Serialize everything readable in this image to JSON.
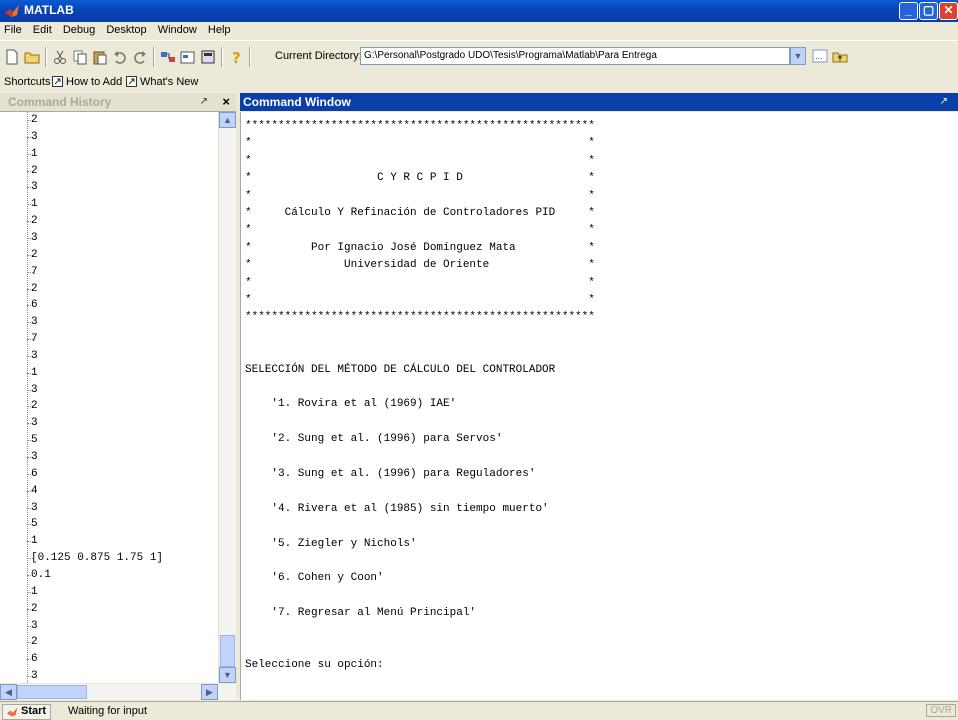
{
  "window": {
    "title": "MATLAB"
  },
  "menu": [
    "File",
    "Edit",
    "Debug",
    "Desktop",
    "Window",
    "Help"
  ],
  "toolbar": {
    "current_directory_label": "Current Directory:",
    "current_directory_value": "G:\\Personal\\Postgrado UDO\\Tesis\\Programa\\Matlab\\Para Entrega"
  },
  "shortcuts": {
    "label": "Shortcuts",
    "how_to_add": "How to Add",
    "whats_new": "What's New"
  },
  "history": {
    "title": "Command History",
    "items": [
      "2",
      "3",
      "1",
      "2",
      "3",
      "1",
      "2",
      "3",
      "2",
      "7",
      "2",
      "6",
      "3",
      "7",
      "3",
      "1",
      "3",
      "2",
      "3",
      "5",
      "3",
      "6",
      "4",
      "3",
      "5",
      "1",
      "[0.125 0.875 1.75 1]",
      "0.1",
      "1",
      "2",
      "3",
      "2",
      "6",
      "3"
    ]
  },
  "command_window": {
    "title": "Command Window",
    "lines": [
      "*****************************************************",
      "*                                                   *",
      "*                                                   *",
      "*                   C Y R C P I D                   *",
      "*                                                   *",
      "*     Cálculo Y Refinación de Controladores PID     *",
      "*                                                   *",
      "*         Por Ignacio José Domínguez Mata           *",
      "*              Universidad de Oriente               *",
      "*                                                   *",
      "*                                                   *",
      "*****************************************************",
      "",
      "",
      "SELECCIÓN DEL MÉTODO DE CÁLCULO DEL CONTROLADOR",
      "",
      "    '1. Rovira et al (1969) IAE'",
      "",
      "    '2. Sung et al. (1996) para Servos'",
      "",
      "    '3. Sung et al. (1996) para Reguladores'",
      "",
      "    '4. Rivera et al (1985) sin tiempo muerto'",
      "",
      "    '5. Ziegler y Nichols'",
      "",
      "    '6. Cohen y Coon'",
      "",
      "    '7. Regresar al Menú Principal'",
      "",
      "",
      "Seleccione su opción:"
    ]
  },
  "status": {
    "start": "Start",
    "message": "Waiting for input",
    "ovr": "OVR"
  }
}
